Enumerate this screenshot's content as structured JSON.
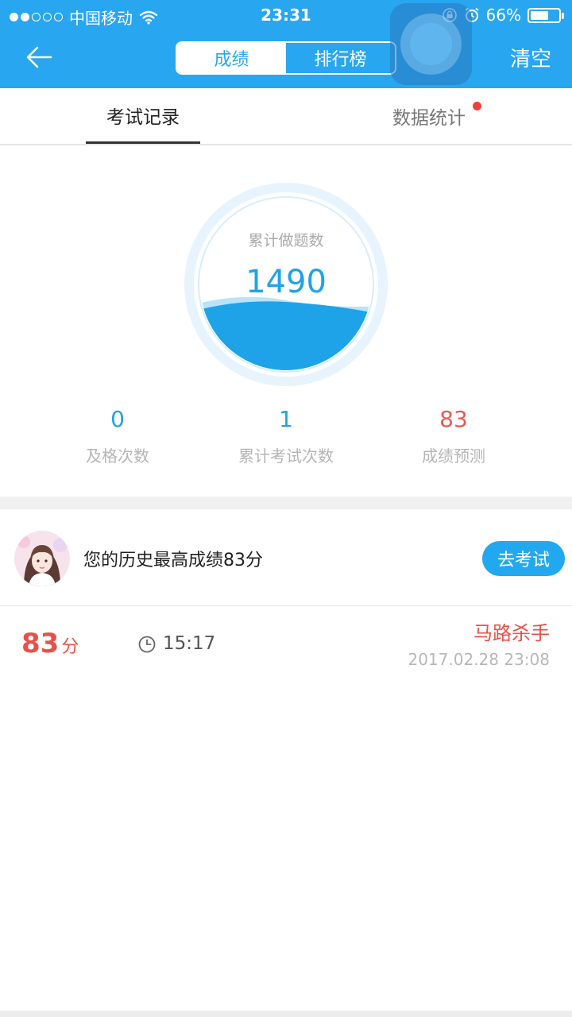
{
  "status_bar": {
    "carrier": "中国移动",
    "time": "23:31",
    "battery_percent": "66%",
    "battery_level": 0.66
  },
  "nav": {
    "segments": [
      "成绩",
      "排行榜"
    ],
    "active_segment": 0,
    "clear_label": "清空"
  },
  "sub_tabs": {
    "items": [
      "考试记录",
      "数据统计"
    ],
    "active": 0,
    "badge_on": "数据统计"
  },
  "gauge": {
    "label": "累计做题数",
    "value": "1490"
  },
  "stats": [
    {
      "value": "0",
      "label": "及格次数"
    },
    {
      "value": "1",
      "label": "累计考试次数"
    },
    {
      "value": "83",
      "label": "成绩预测"
    }
  ],
  "best": {
    "text": "您的历史最高成绩83分",
    "button_label": "去考试"
  },
  "records": [
    {
      "score": "83",
      "unit": "分",
      "duration": "15:17",
      "title": "马路杀手",
      "date": "2017.02.28 23:08"
    }
  ],
  "colors": {
    "header": "#28a6f0",
    "accent": "#1ea3e8",
    "danger": "#e8514a"
  },
  "icons": [
    "signal-dots-icon",
    "wifi-icon",
    "lock-rotation-icon",
    "alarm-icon",
    "battery-icon",
    "back-arrow-icon",
    "clock-icon"
  ]
}
